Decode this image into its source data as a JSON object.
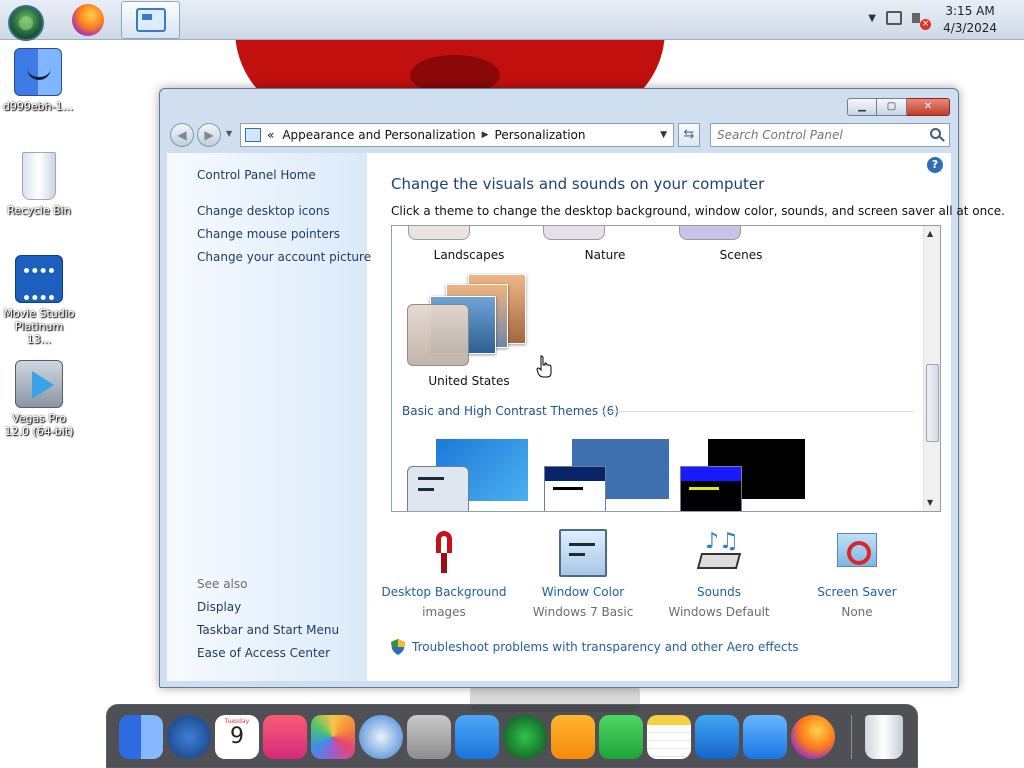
{
  "taskbar": {
    "time": "3:15 AM",
    "date": "4/3/2024"
  },
  "desktop": {
    "icons": [
      {
        "label": "d999ebh-1...",
        "icon": "finder-icon"
      },
      {
        "label": "Recycle Bin",
        "icon": "recycle-bin-icon"
      },
      {
        "label": "Movie Studio Platinum 13...",
        "icon": "movie-studio-icon"
      },
      {
        "label": "Vegas Pro 12.0 (64-bit)",
        "icon": "vegas-pro-icon"
      }
    ]
  },
  "window": {
    "address": {
      "root_chevron": "«",
      "crumbs": [
        "Appearance and Personalization",
        "Personalization"
      ]
    },
    "search_placeholder": "Search Control Panel",
    "sidebar": {
      "home": "Control Panel Home",
      "links": [
        "Change desktop icons",
        "Change mouse pointers",
        "Change your account picture"
      ],
      "see_also_heading": "See also",
      "see_also": [
        "Display",
        "Taskbar and Start Menu",
        "Ease of Access Center"
      ]
    },
    "main": {
      "title": "Change the visuals and sounds on your computer",
      "subtitle": "Click a theme to change the desktop background, window color, sounds, and screen saver all at once.",
      "themes_row": [
        "Landscapes",
        "Nature",
        "Scenes"
      ],
      "selected_theme": "United States",
      "basic_section": "Basic and High Contrast Themes (6)",
      "tiles": [
        {
          "label": "Desktop Background",
          "value": "images"
        },
        {
          "label": "Window Color",
          "value": "Windows 7 Basic"
        },
        {
          "label": "Sounds",
          "value": "Windows Default"
        },
        {
          "label": "Screen Saver",
          "value": "None"
        }
      ],
      "troubleshoot": "Troubleshoot problems with transparency and other Aero effects"
    }
  },
  "dock": {
    "calendar_day": "9",
    "calendar_weekday": "Tuesday",
    "icons": [
      "finder-icon",
      "launchpad-icon",
      "calendar-icon",
      "music-icon",
      "photos-icon",
      "safari-icon",
      "contacts-icon",
      "icloud-icon",
      "radar-icon",
      "pages-icon",
      "numbers-icon",
      "notes-icon",
      "keynote-icon",
      "mail-icon",
      "firefox-icon",
      "trash-icon"
    ]
  }
}
